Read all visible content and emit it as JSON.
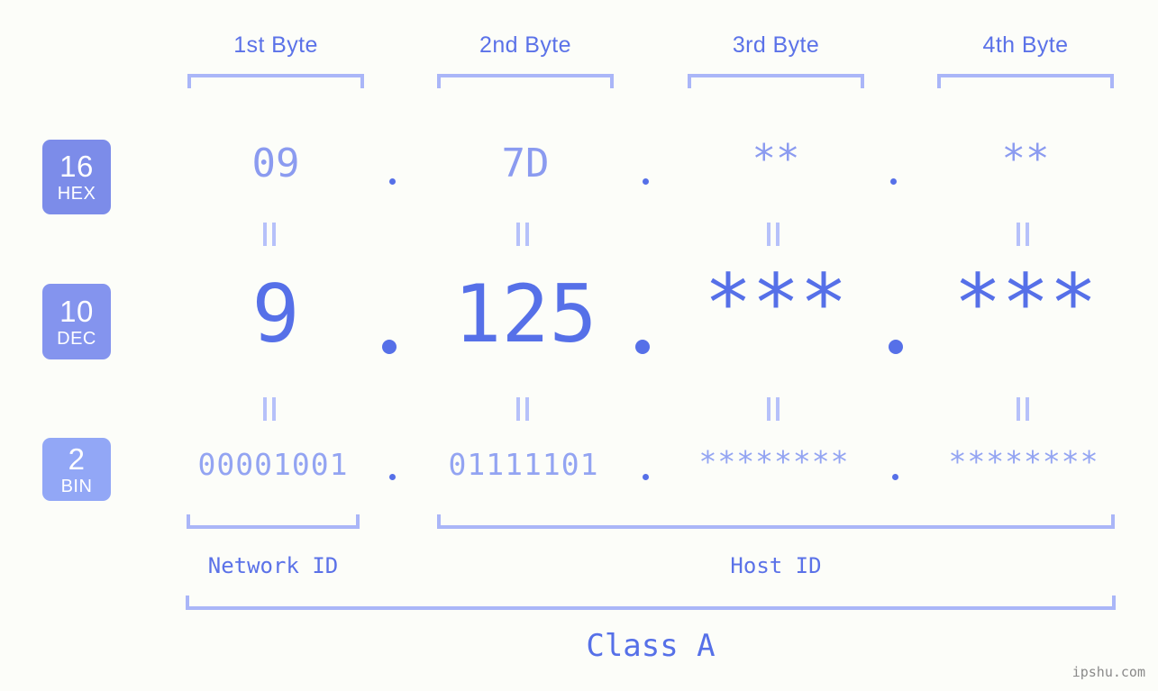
{
  "meta": {
    "background_color": "#fcfdf9",
    "accent_strong": "#5670e8",
    "accent_mid": "#8b9bf0",
    "accent_light": "#aab6f8",
    "watermark": "ipshu.com"
  },
  "byte_headers": [
    {
      "label": "1st Byte"
    },
    {
      "label": "2nd Byte"
    },
    {
      "label": "3rd Byte"
    },
    {
      "label": "4th Byte"
    }
  ],
  "rows": [
    {
      "key": "hex",
      "base": "16",
      "abbr": "HEX",
      "badge_color": "#7c8ce9",
      "values": [
        "09",
        "7D",
        "**",
        "**"
      ],
      "separator": "."
    },
    {
      "key": "dec",
      "base": "10",
      "abbr": "DEC",
      "badge_color": "#8494ee",
      "values": [
        "9",
        "125",
        "***",
        "***"
      ],
      "separator": "."
    },
    {
      "key": "bin",
      "base": "2",
      "abbr": "BIN",
      "badge_color": "#92a7f6",
      "values": [
        "00001001",
        "01111101",
        "********",
        "********"
      ],
      "separator": "."
    }
  ],
  "equals_glyph": "=",
  "segments": {
    "network_id": "Network ID",
    "host_id": "Host ID"
  },
  "class_label": "Class A"
}
